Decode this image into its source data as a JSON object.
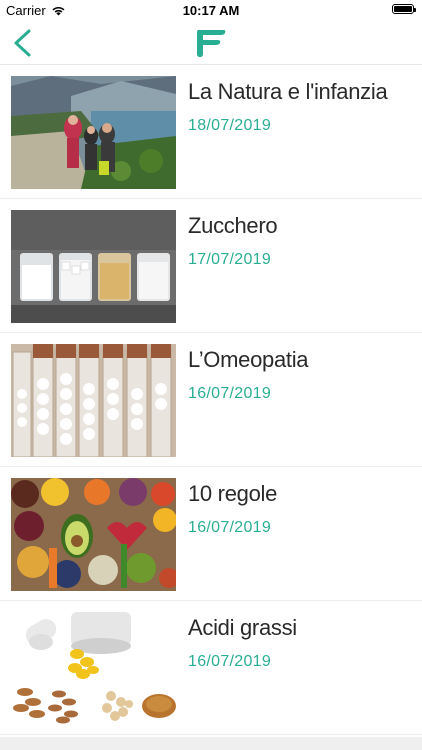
{
  "status_bar": {
    "carrier": "Carrier",
    "time": "10:17 AM"
  },
  "nav": {
    "back_icon": "chevron-left-icon",
    "logo": "app-logo-f",
    "accent_color": "#2aae93"
  },
  "articles": [
    {
      "title": "La Natura e l'infanzia",
      "date": "18/07/2019",
      "image": "family-hiking-lake-photo"
    },
    {
      "title": "Zucchero",
      "date": "17/07/2019",
      "image": "sugar-jars-photo"
    },
    {
      "title": "L’Omeopatia",
      "date": "16/07/2019",
      "image": "homeopathy-vials-photo"
    },
    {
      "title": "10 regole",
      "date": "16/07/2019",
      "image": "healthy-food-photo"
    },
    {
      "title": "Acidi grassi",
      "date": "16/07/2019",
      "image": "nuts-oils-photo"
    }
  ]
}
